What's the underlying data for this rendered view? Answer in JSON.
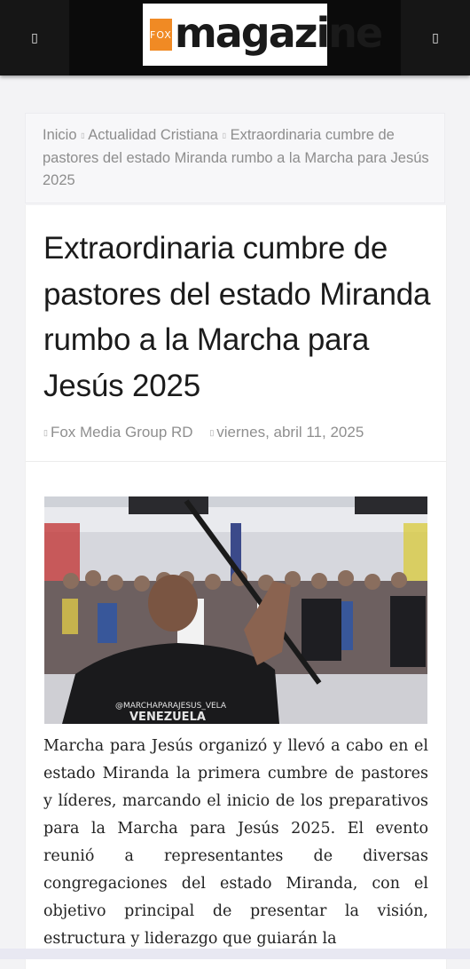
{
  "header": {
    "menu_icon": "menu-icon",
    "search_icon": "search-icon",
    "logo": {
      "box_text": "FOX",
      "word": "magazine",
      "accent_color": "#f08a24"
    }
  },
  "breadcrumb": {
    "items": [
      "Inicio",
      "Actualidad Cristiana",
      "Extraordinaria cumbre de pastores del estado Miranda rumbo a la Marcha para Jesús 2025"
    ]
  },
  "article": {
    "title": "Extraordinaria cumbre de pastores del estado Miranda rumbo a la Marcha para Jesús 2025",
    "author": "Fox Media Group RD",
    "date": "viernes, abril 11, 2025",
    "image_shirt_text_1": "@MARCHAPARAJESUS_VELA",
    "image_shirt_text_2": "VENEZUELA",
    "body": "Marcha para Jesús organizó y llevó a cabo en el estado Miranda la primera cumbre de pastores y líderes, marcando el inicio de los preparativos para la Marcha para Jesús 2025. El evento reunió a representantes de diversas congregaciones del estado Miranda, con el objetivo principal de presentar la visión, estructura y liderazgo que guiarán la"
  }
}
